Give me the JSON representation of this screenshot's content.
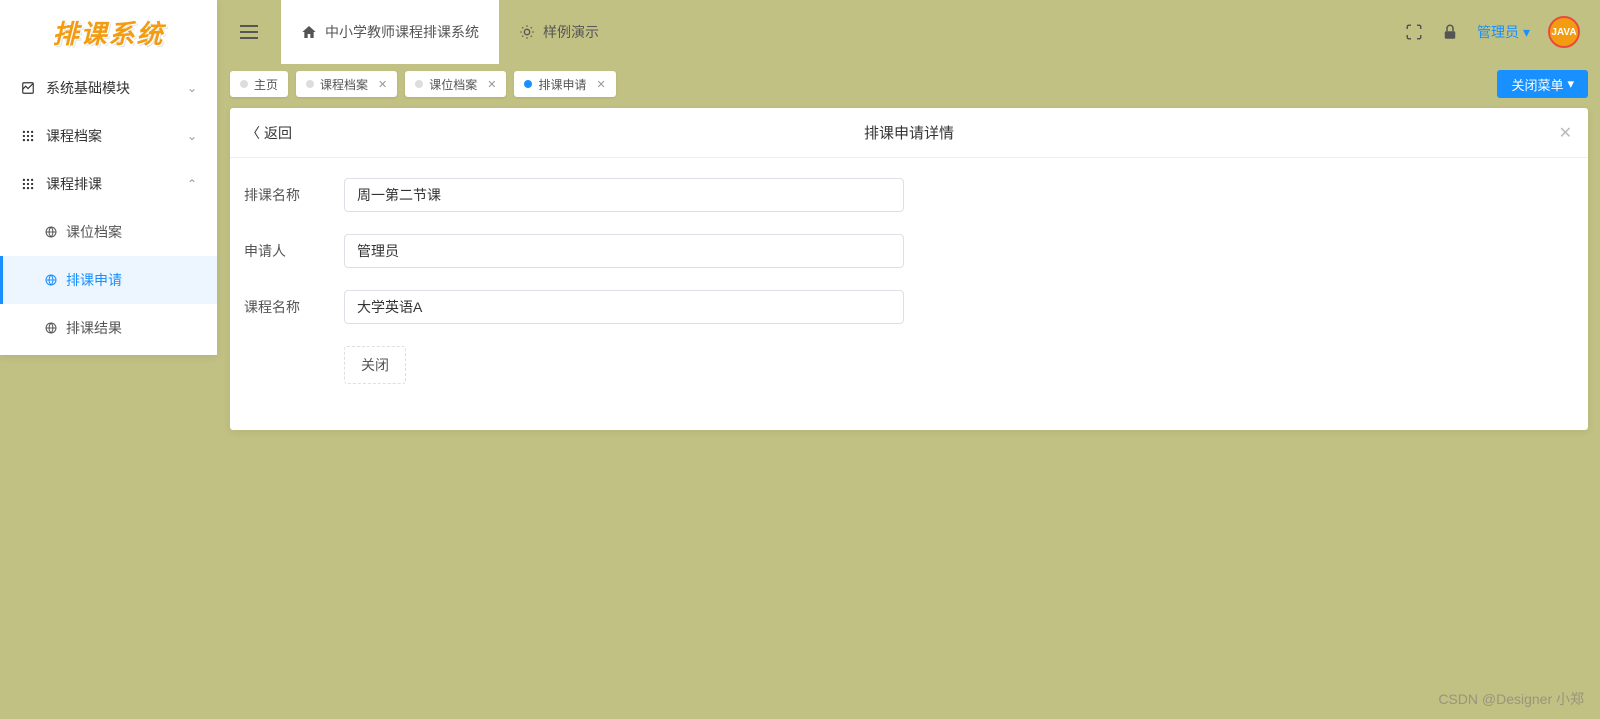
{
  "logo": "排课系统",
  "sidebar": {
    "items": [
      {
        "label": "系统基础模块",
        "expanded": false
      },
      {
        "label": "课程档案",
        "expanded": false
      },
      {
        "label": "课程排课",
        "expanded": true,
        "children": [
          {
            "label": "课位档案",
            "active": false
          },
          {
            "label": "排课申请",
            "active": true
          },
          {
            "label": "排课结果",
            "active": false
          }
        ]
      }
    ]
  },
  "header": {
    "tabs": [
      {
        "label": "中小学教师课程排课系统",
        "active": true,
        "icon": "home"
      },
      {
        "label": "样例演示",
        "active": false,
        "icon": "sun"
      }
    ],
    "user": "管理员",
    "avatar": "JAVA"
  },
  "pageTabs": {
    "items": [
      {
        "label": "主页",
        "active": false,
        "closable": false
      },
      {
        "label": "课程档案",
        "active": false,
        "closable": true
      },
      {
        "label": "课位档案",
        "active": false,
        "closable": true
      },
      {
        "label": "排课申请",
        "active": true,
        "closable": true
      }
    ],
    "closeMenu": "关闭菜单"
  },
  "content": {
    "back": "返回",
    "title": "排课申请详情",
    "form": {
      "rows": [
        {
          "label": "排课名称",
          "value": "周一第二节课"
        },
        {
          "label": "申请人",
          "value": "管理员"
        },
        {
          "label": "课程名称",
          "value": "大学英语A"
        }
      ],
      "close": "关闭"
    }
  },
  "watermark": "CSDN @Designer 小郑"
}
